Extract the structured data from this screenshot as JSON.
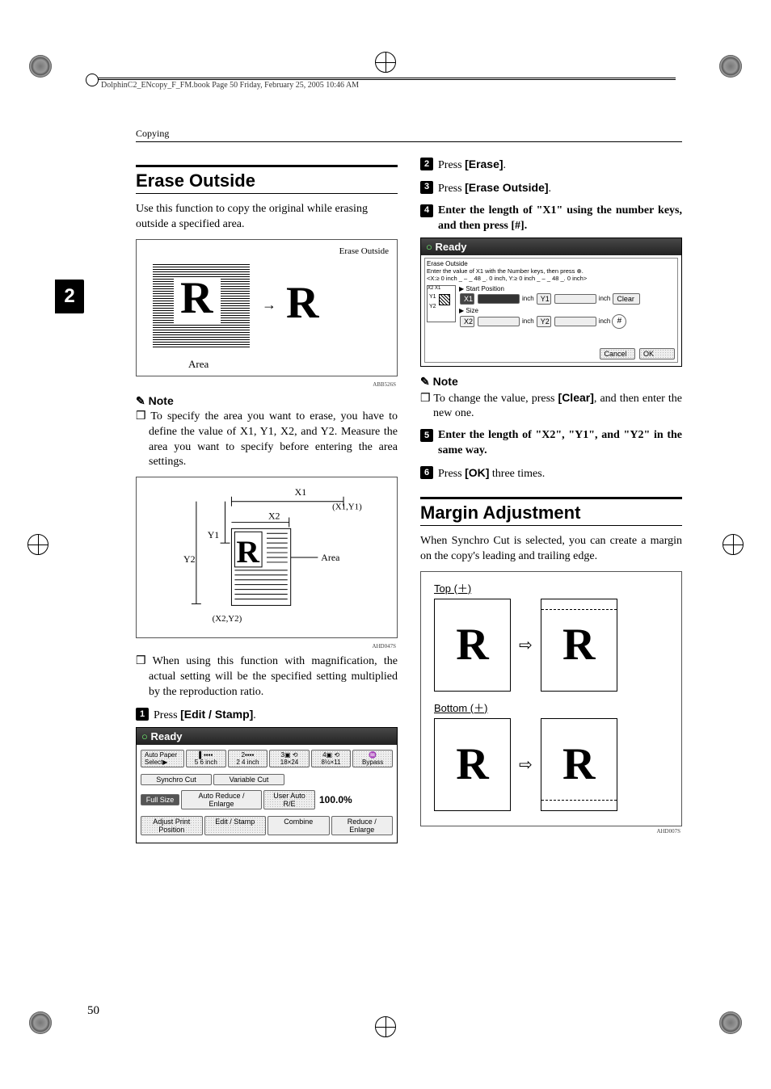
{
  "book_header": "DolphinC2_ENcopy_F_FM.book  Page 50  Friday, February 25, 2005  10:46 AM",
  "running_head": "Copying",
  "tab_number": "2",
  "page_number": "50",
  "left": {
    "section_title": "Erase Outside",
    "intro": "Use this function to copy the original while erasing outside a specified area.",
    "fig1": {
      "label": "Erase Outside",
      "area": "Area",
      "id": "ABB526S"
    },
    "note_label": "Note",
    "notes": [
      "To specify the area you want to erase, you have to define the value of X1, Y1, X2, and Y2. Measure the area you want to specify before entering the area settings.",
      "When using this function with magnification, the actual setting will be the specified setting multiplied by the reproduction ratio."
    ],
    "fig2": {
      "x1": "X1",
      "x2": "X2",
      "y1": "Y1",
      "y2": "Y2",
      "p1": "(X1,Y1)",
      "p2": "(X2,Y2)",
      "area": "Area",
      "id": "AHD047S"
    },
    "step1": {
      "prefix": "Press ",
      "label": "[Edit / Stamp]",
      "suffix": "."
    },
    "screenshot1": {
      "title": "Ready",
      "auto_paper": "Auto Paper Select▶",
      "size_a": "5 6 inch",
      "size_b": "2 4 inch",
      "size_c": "18×24",
      "size_d": "8½×11",
      "bypass": "Bypass",
      "synchro": "Synchro Cut",
      "variable": "Variable Cut",
      "full": "Full Size",
      "autore": "Auto Reduce / Enlarge",
      "userre": "User Auto R/E",
      "ratio": "100.0%",
      "adjust": "Adjust Print Position",
      "edit": "Edit / Stamp",
      "combine": "Combine",
      "reduce": "Reduce / Enlarge"
    }
  },
  "right": {
    "step2": {
      "prefix": "Press ",
      "label": "[Erase]",
      "suffix": "."
    },
    "step3": {
      "prefix": "Press ",
      "label": "[Erase Outside]",
      "suffix": "."
    },
    "step4": "Enter the length of \"X1\" using the number keys, and then press [#].",
    "screenshot2": {
      "title": "Ready",
      "sub": "Erase Outside",
      "desc": "Enter the value of X1 with the Number keys, then press ⊕.",
      "range": "<X:≥ 0  inch _ – _ 48 _. 0  inch, Y:≥ 0  inch _ – _ 48 _. 0  inch>",
      "start": "▶ Start Position",
      "size": "▶ Size",
      "x1": "X1",
      "y1": "Y1",
      "x2": "X2",
      "y2": "Y2",
      "inch": "inch",
      "clear": "Clear",
      "cancel": "Cancel",
      "ok": "OK"
    },
    "note_label": "Note",
    "note_item_a": "To change the value, press ",
    "note_item_b": "[Clear]",
    "note_item_c": ", and then enter the new one.",
    "step5": "Enter the length of \"X2\", \"Y1\", and \"Y2\" in the same way.",
    "step6": {
      "prefix": "Press ",
      "label": "[OK]",
      "suffix": " three times."
    },
    "section_title": "Margin Adjustment",
    "intro": "When Synchro Cut is selected, you can create a margin on the copy's leading and trailing edge.",
    "fig3": {
      "top": "Top (＋)",
      "bottom": "Bottom (＋)",
      "id": "AHD007S"
    }
  }
}
